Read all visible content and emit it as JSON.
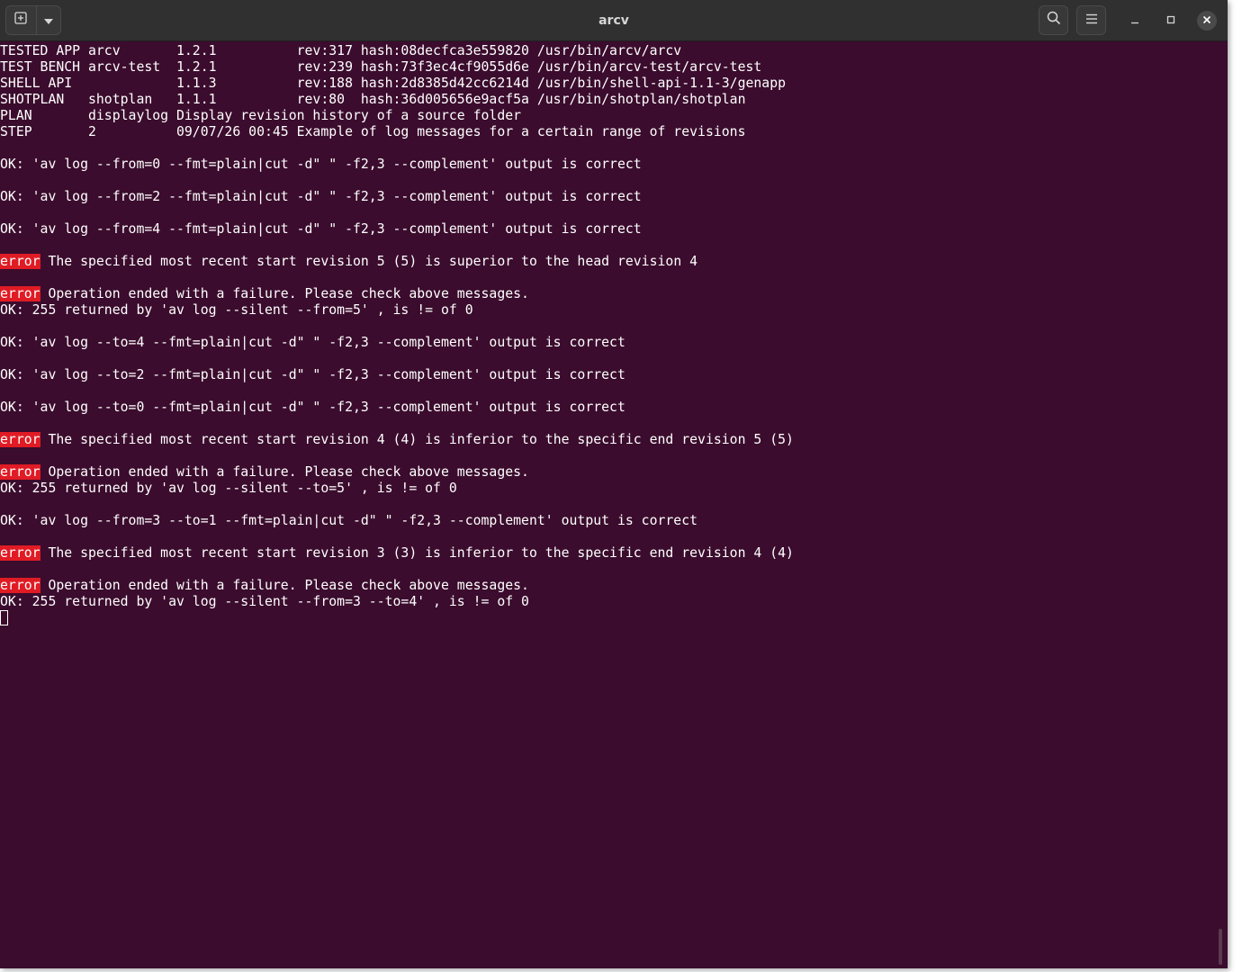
{
  "window": {
    "title": "arcv",
    "colors": {
      "terminal_bg": "#3b0c2d",
      "titlebar_bg": "#303030",
      "error_bg": "#e01b24",
      "text": "#ffffff"
    }
  },
  "toolbar": {
    "new_tab_icon": "new-tab-icon",
    "dropdown_icon": "chevron-down-icon",
    "search_icon": "search-icon",
    "menu_icon": "hamburger-menu-icon",
    "minimize_icon": "minimize-icon",
    "maximize_icon": "maximize-icon",
    "close_icon": "close-icon"
  },
  "terminal": {
    "lines": [
      {
        "text": "TESTED APP arcv       1.2.1          rev:317 hash:08decfca3e559820 /usr/bin/arcv/arcv"
      },
      {
        "text": "TEST BENCH arcv-test  1.2.1          rev:239 hash:73f3ec4cf9055d6e /usr/bin/arcv-test/arcv-test"
      },
      {
        "text": "SHELL API             1.1.3          rev:188 hash:2d8385d42cc6214d /usr/bin/shell-api-1.1-3/genapp"
      },
      {
        "text": "SHOTPLAN   shotplan   1.1.1          rev:80  hash:36d005656e9acf5a /usr/bin/shotplan/shotplan"
      },
      {
        "text": "PLAN       displaylog Display revision history of a source folder"
      },
      {
        "text": "STEP       2          09/07/26 00:45 Example of log messages for a certain range of revisions"
      },
      {
        "text": ""
      },
      {
        "text": "OK: 'av log --from=0 --fmt=plain|cut -d\" \" -f2,3 --complement' output is correct"
      },
      {
        "text": ""
      },
      {
        "text": "OK: 'av log --from=2 --fmt=plain|cut -d\" \" -f2,3 --complement' output is correct"
      },
      {
        "text": ""
      },
      {
        "text": "OK: 'av log --from=4 --fmt=plain|cut -d\" \" -f2,3 --complement' output is correct"
      },
      {
        "text": ""
      },
      {
        "badge": "error",
        "text": " The specified most recent start revision 5 (5) is superior to the head revision 4"
      },
      {
        "text": ""
      },
      {
        "badge": "error",
        "text": " Operation ended with a failure. Please check above messages."
      },
      {
        "text": "OK: 255 returned by 'av log --silent --from=5' , is != of 0"
      },
      {
        "text": ""
      },
      {
        "text": "OK: 'av log --to=4 --fmt=plain|cut -d\" \" -f2,3 --complement' output is correct"
      },
      {
        "text": ""
      },
      {
        "text": "OK: 'av log --to=2 --fmt=plain|cut -d\" \" -f2,3 --complement' output is correct"
      },
      {
        "text": ""
      },
      {
        "text": "OK: 'av log --to=0 --fmt=plain|cut -d\" \" -f2,3 --complement' output is correct"
      },
      {
        "text": ""
      },
      {
        "badge": "error",
        "text": " The specified most recent start revision 4 (4) is inferior to the specific end revision 5 (5)"
      },
      {
        "text": ""
      },
      {
        "badge": "error",
        "text": " Operation ended with a failure. Please check above messages."
      },
      {
        "text": "OK: 255 returned by 'av log --silent --to=5' , is != of 0"
      },
      {
        "text": ""
      },
      {
        "text": "OK: 'av log --from=3 --to=1 --fmt=plain|cut -d\" \" -f2,3 --complement' output is correct"
      },
      {
        "text": ""
      },
      {
        "badge": "error",
        "text": " The specified most recent start revision 3 (3) is inferior to the specific end revision 4 (4)"
      },
      {
        "text": ""
      },
      {
        "badge": "error",
        "text": " Operation ended with a failure. Please check above messages."
      },
      {
        "text": "OK: 255 returned by 'av log --silent --from=3 --to=4' , is != of 0"
      }
    ]
  }
}
